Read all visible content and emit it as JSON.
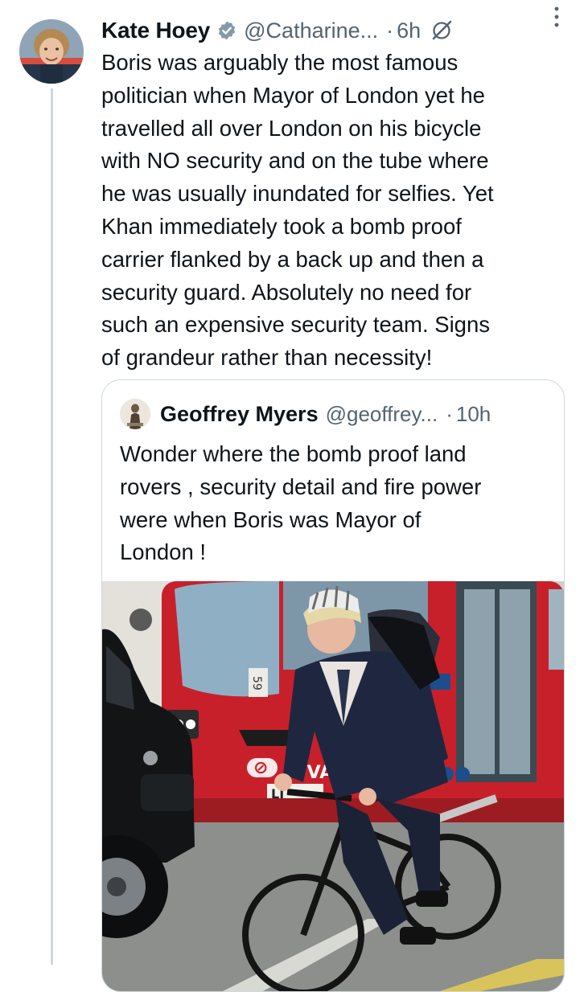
{
  "tweet": {
    "author_name": "Kate Hoey",
    "handle": "@Catharine...",
    "separator": "·",
    "time": "6h",
    "text": "Boris was arguably the  most famous\npolitician when Mayor of London yet he\ntravelled all over London on his bicycle\nwith NO security and on the tube where\nhe was usually inundated for selfies. Yet\nKhan immediately took a  bomb proof\ncarrier flanked by a back up and then a\nsecurity guard. Absolutely no need for\nsuch an expensive security team. Signs\nof grandeur rather than necessity!",
    "icons": [
      "avatar",
      "verified-badge-icon",
      "grok-icon",
      "more-options-icon"
    ]
  },
  "quoted_tweet": {
    "author_name": "Geoffrey Myers",
    "handle": "@geoffrey...",
    "separator": "·",
    "time": "10h",
    "text": "Wonder where the bomb proof land\nrovers , security detail and fire power\nwere when Boris was Mayor of\nLondon !",
    "image_visible_text": {
      "bus_logo": "A  VA",
      "plate": "LJ",
      "bus_sign": "59"
    }
  },
  "colors": {
    "text_primary": "#0f1419",
    "text_secondary": "#536471",
    "verified": "#829aab",
    "border": "#cfd9de",
    "bus_red": "#c8202a"
  }
}
